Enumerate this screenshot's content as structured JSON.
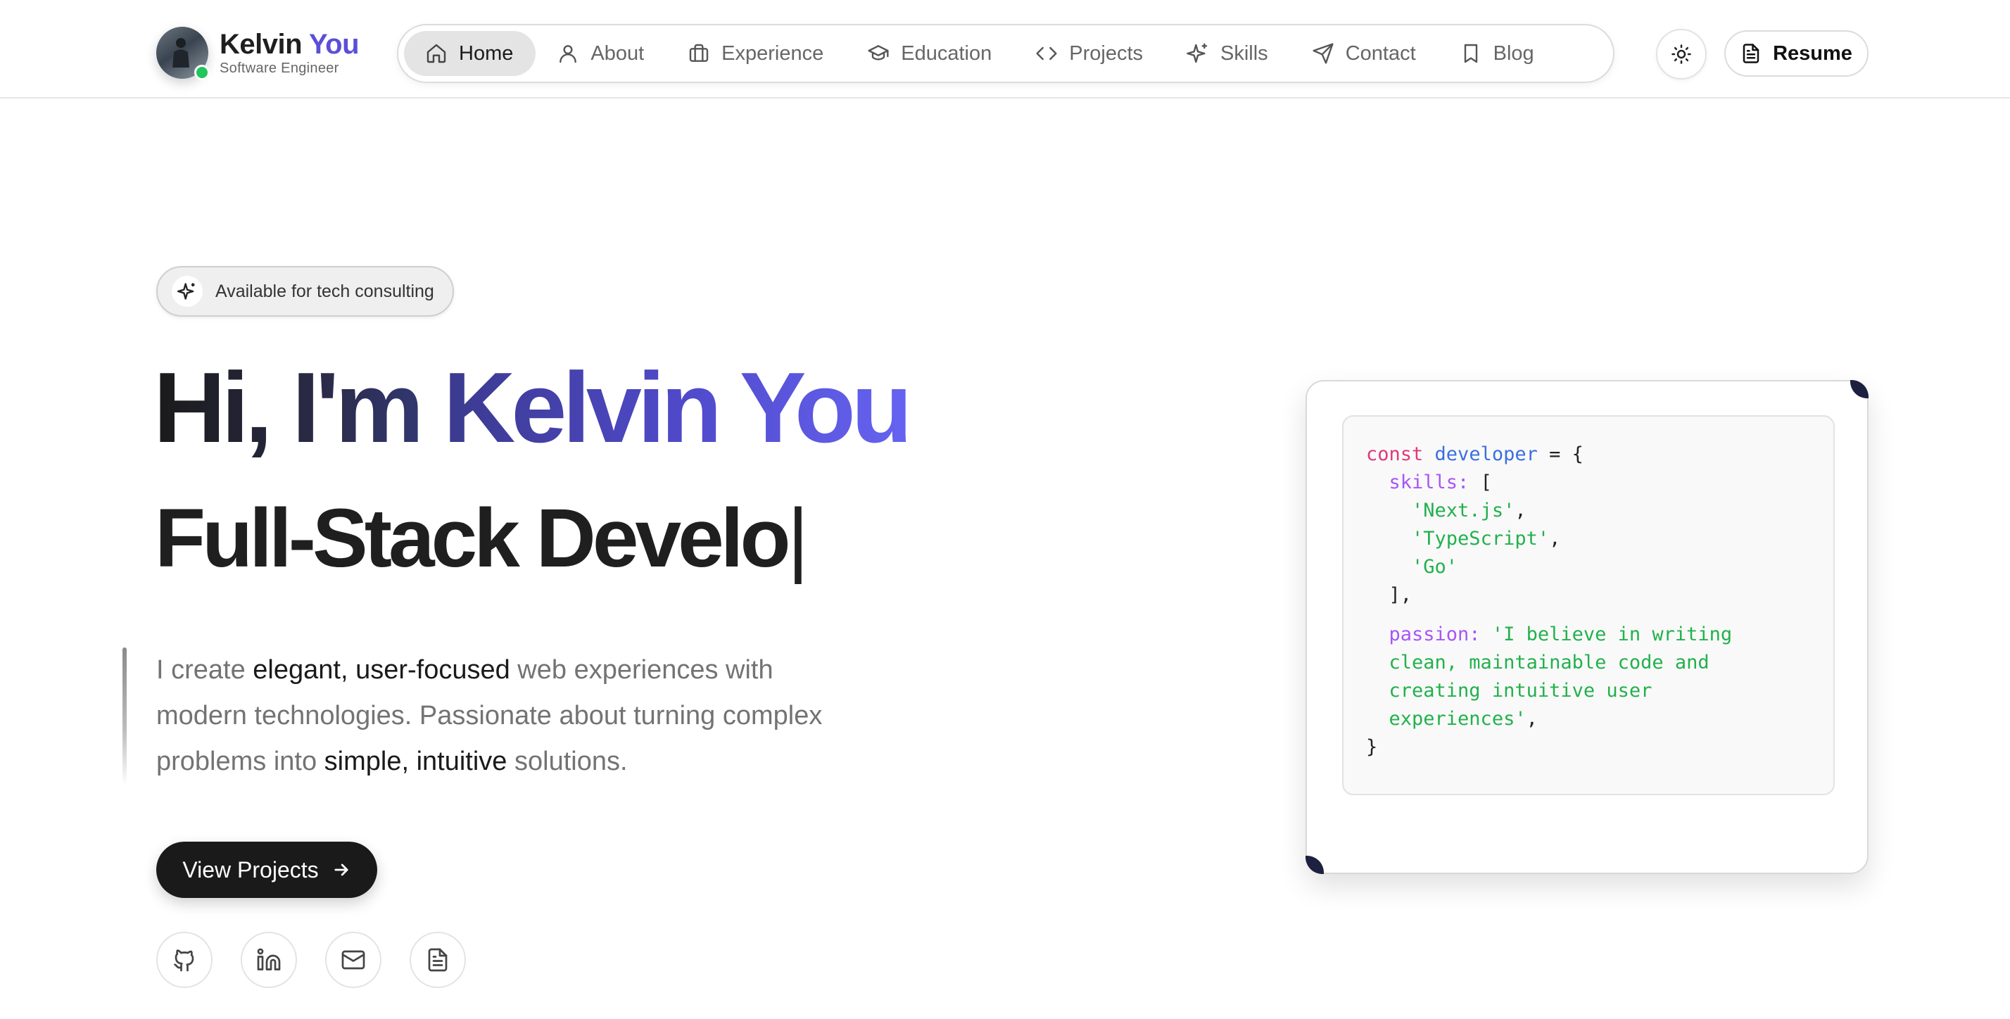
{
  "brand": {
    "first_name": "Kelvin",
    "last_name": "You",
    "subtitle": "Software Engineer"
  },
  "nav": {
    "items": [
      {
        "label": "Home",
        "icon": "home-icon",
        "active": true
      },
      {
        "label": "About",
        "icon": "user-icon",
        "active": false
      },
      {
        "label": "Experience",
        "icon": "briefcase-icon",
        "active": false
      },
      {
        "label": "Education",
        "icon": "graduation-cap-icon",
        "active": false
      },
      {
        "label": "Projects",
        "icon": "code-icon",
        "active": false
      },
      {
        "label": "Skills",
        "icon": "sparkles-icon",
        "active": false
      },
      {
        "label": "Contact",
        "icon": "send-icon",
        "active": false
      },
      {
        "label": "Blog",
        "icon": "bookmark-icon",
        "active": false
      }
    ],
    "theme_toggle_icon": "sun-icon",
    "resume_label": "Resume"
  },
  "hero": {
    "badge": "Available for tech consulting",
    "greeting": "Hi, I'm ",
    "name": "Kelvin You",
    "role_typed": "Full-Stack Develo",
    "cursor": "|",
    "intro": {
      "p1": "I create ",
      "b1": "elegant, user-focused",
      "p2": " web experiences with modern technologies. Passionate about turning complex problems into ",
      "b2": "simple, intuitive",
      "p3": " solutions."
    },
    "cta_label": "View Projects",
    "socials": [
      "github-icon",
      "linkedin-icon",
      "mail-icon",
      "file-text-icon"
    ]
  },
  "code": {
    "kw": "const",
    "var": "developer",
    "open": " = {",
    "skills_key": "skills:",
    "skills_open": " [",
    "skills": [
      "'Next.js'",
      "'TypeScript'",
      "'Go'"
    ],
    "skills_close": "],",
    "passion_key": "passion:",
    "passion_lines": [
      "'I believe in writing",
      "clean, maintainable code and",
      "creating intuitive user",
      "experiences'"
    ],
    "close": "}"
  },
  "colors": {
    "accent": "#5b4fd6",
    "status": "#22c55e",
    "code_keyword": "#e0397b",
    "code_var": "#3b6fe0",
    "code_prop": "#a855f7",
    "code_string": "#22b14c"
  }
}
